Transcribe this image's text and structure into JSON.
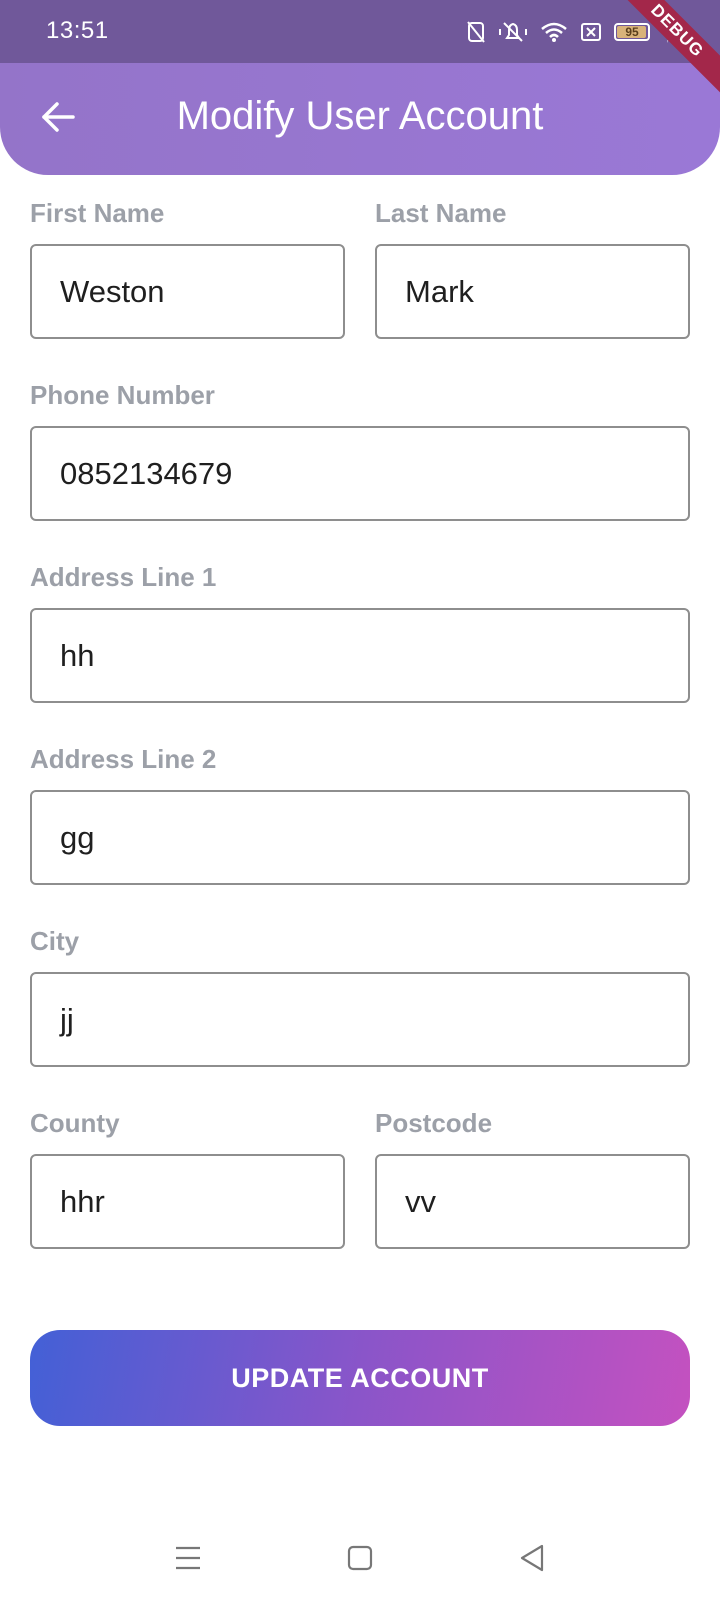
{
  "status_bar": {
    "time": "13:51",
    "battery_level": "95",
    "icons": [
      "nfc-icon",
      "mute-icon",
      "wifi-icon",
      "sim-icon",
      "battery-icon",
      "charging-icon"
    ]
  },
  "debug_banner": "DEBUG",
  "app_bar": {
    "title": "Modify User Account",
    "back_icon": "arrow-back-icon"
  },
  "form": {
    "first_name": {
      "label": "First Name",
      "value": "Weston"
    },
    "last_name": {
      "label": "Last Name",
      "value": "Mark"
    },
    "phone": {
      "label": "Phone Number",
      "value": "0852134679"
    },
    "address1": {
      "label": "Address Line 1",
      "value": "hh"
    },
    "address2": {
      "label": "Address Line 2",
      "value": "gg"
    },
    "city": {
      "label": "City",
      "value": "jj"
    },
    "county": {
      "label": "County",
      "value": "hhr"
    },
    "postcode": {
      "label": "Postcode",
      "value": "vv"
    }
  },
  "update_button": {
    "label": "UPDATE ACCOUNT"
  },
  "nav_bar": {
    "icons": [
      "menu-icon",
      "home-icon",
      "back-icon"
    ]
  },
  "colors": {
    "status_bar": "#70589a",
    "app_bar": "#9474c9",
    "label": "#9ca0a8",
    "input_border": "#8e8e8e",
    "button_gradient_start": "#4360d6",
    "button_gradient_end": "#c451c0"
  }
}
